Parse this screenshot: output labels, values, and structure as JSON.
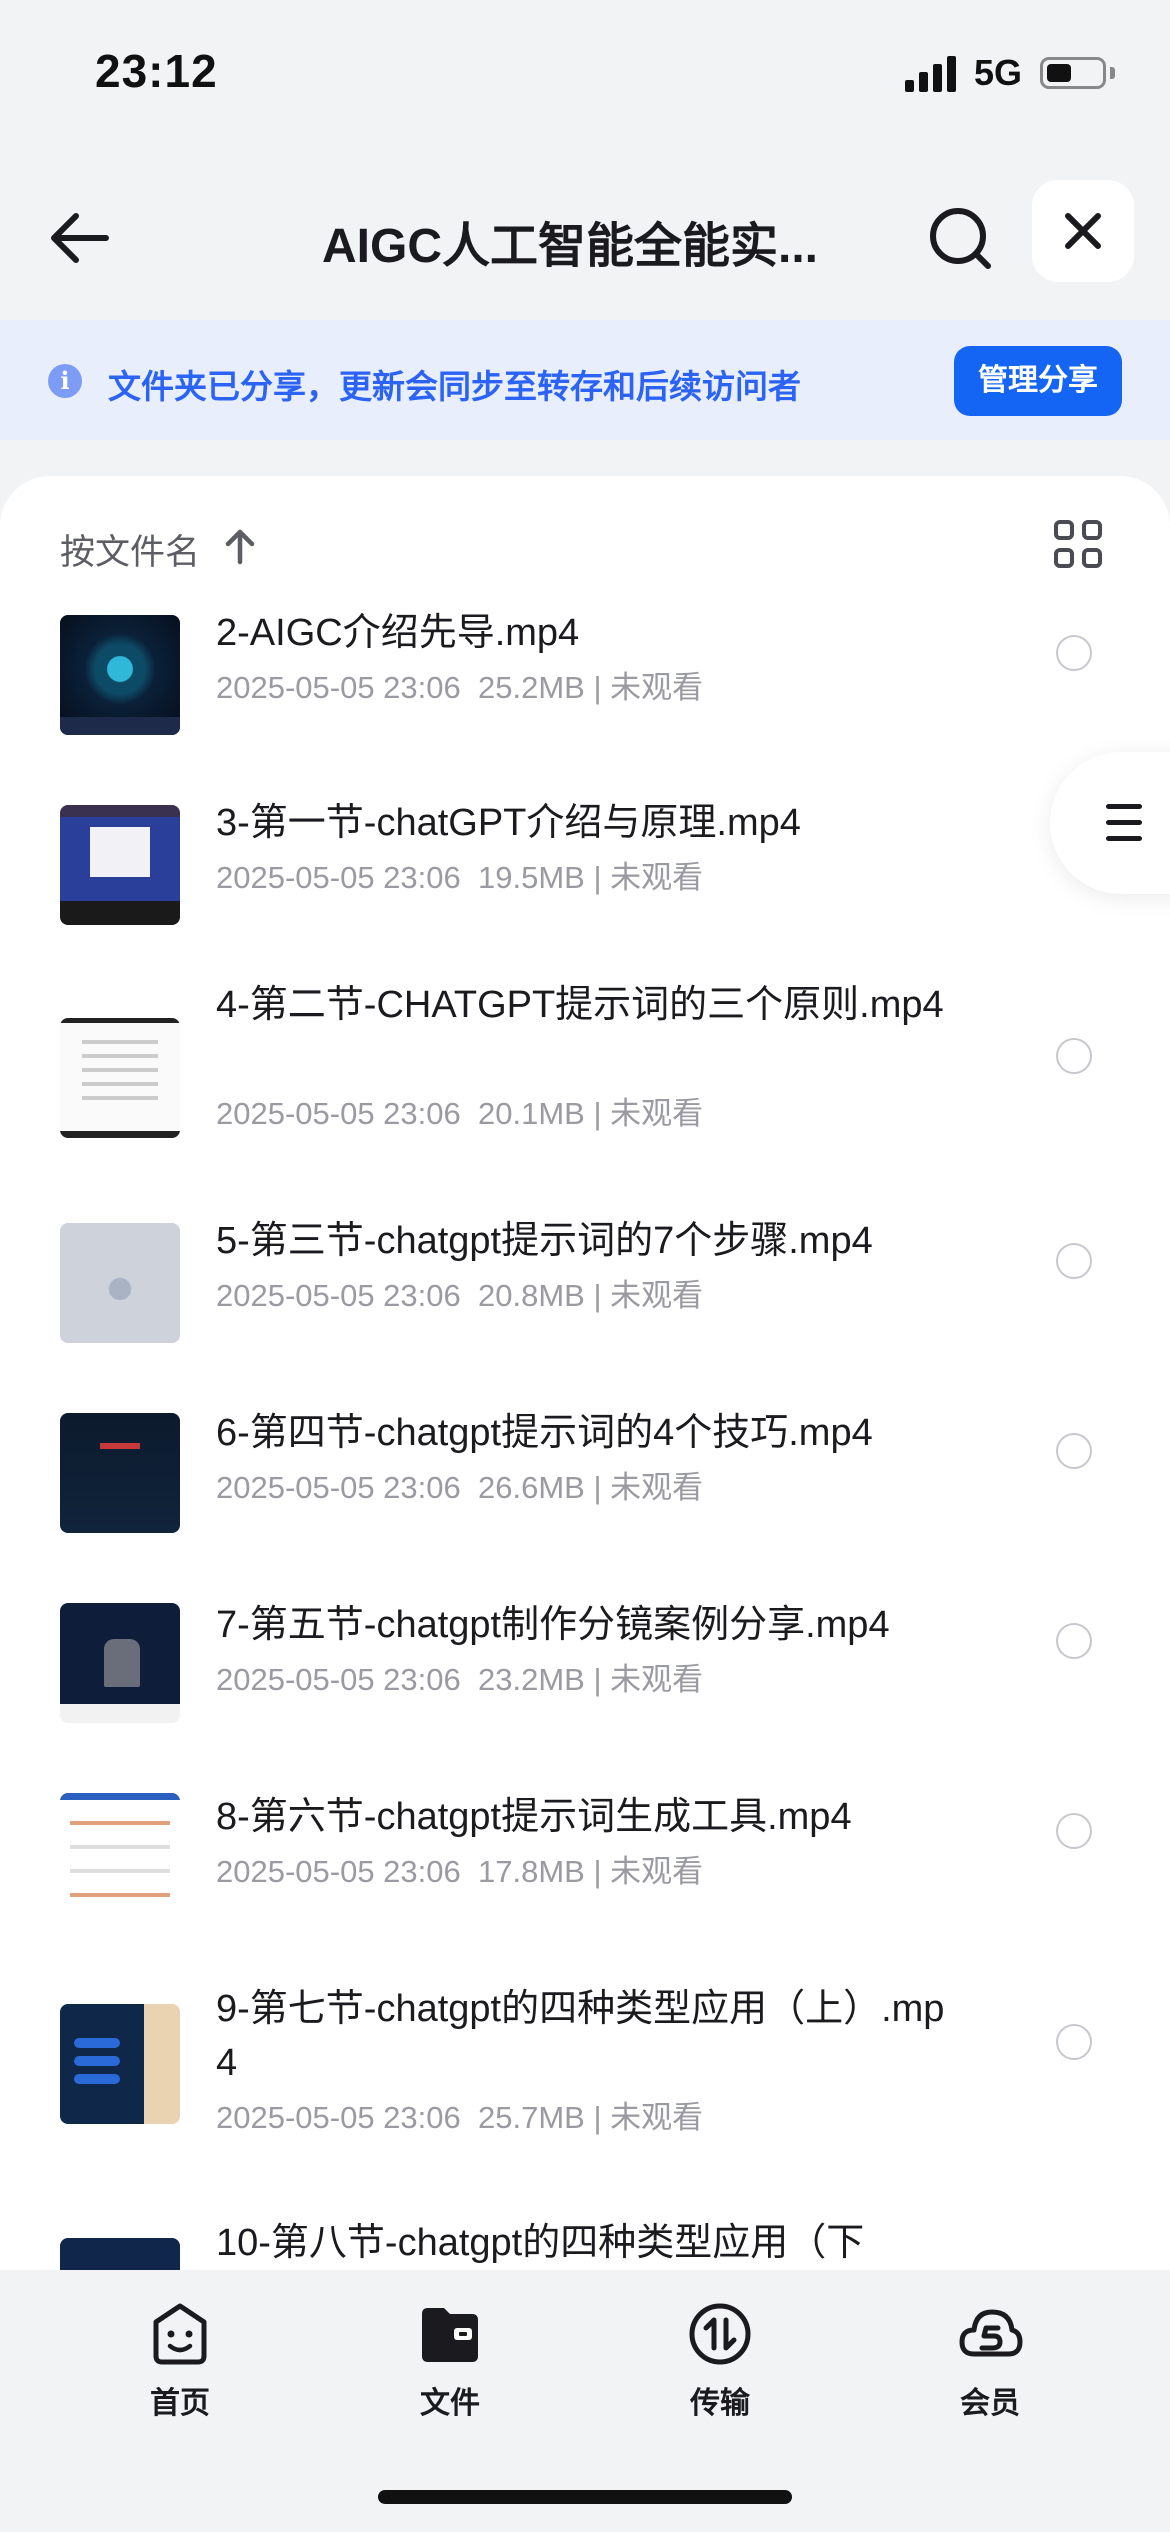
{
  "status_bar": {
    "time": "23:12",
    "network": "5G"
  },
  "nav": {
    "title": "AIGC人工智能全能实..."
  },
  "share_banner": {
    "info_glyph": "i",
    "message": "文件夹已分享，更新会同步至转存和后续访问者",
    "manage_button": "管理分享"
  },
  "sort": {
    "label": "按文件名"
  },
  "files": [
    {
      "name": "2-AIGC介绍先导.mp4",
      "date": "2025-05-05 23:06",
      "size": "25.2MB",
      "status": "未观看"
    },
    {
      "name": "3-第一节-chatGPT介绍与原理.mp4",
      "date": "2025-05-05 23:06",
      "size": "19.5MB",
      "status": "未观看"
    },
    {
      "name": "4-第二节-CHATGPT提示词的三个原则.mp4",
      "date": "2025-05-05 23:06",
      "size": "20.1MB",
      "status": "未观看"
    },
    {
      "name": "5-第三节-chatgpt提示词的7个步骤.mp4",
      "date": "2025-05-05 23:06",
      "size": "20.8MB",
      "status": "未观看"
    },
    {
      "name": "6-第四节-chatgpt提示词的4个技巧.mp4",
      "date": "2025-05-05 23:06",
      "size": "26.6MB",
      "status": "未观看"
    },
    {
      "name": "7-第五节-chatgpt制作分镜案例分享.mp4",
      "date": "2025-05-05 23:06",
      "size": "23.2MB",
      "status": "未观看"
    },
    {
      "name": "8-第六节-chatgpt提示词生成工具.mp4",
      "date": "2025-05-05 23:06",
      "size": "17.8MB",
      "status": "未观看"
    },
    {
      "name": "9-第七节-chatgpt的四种类型应用（上）.mp4",
      "date": "2025-05-05 23:06",
      "size": "25.7MB",
      "status": "未观看"
    },
    {
      "name": "10-第八节-chatgpt的四种类型应用（下",
      "date": "",
      "size": "",
      "status": ""
    }
  ],
  "tabs": [
    {
      "label": "首页",
      "icon": "smile-face-icon"
    },
    {
      "label": "文件",
      "icon": "folder-icon"
    },
    {
      "label": "传输",
      "icon": "transfer-icon"
    },
    {
      "label": "会员",
      "icon": "cloud-member-icon"
    }
  ],
  "colors": {
    "accent": "#1565f4",
    "banner_bg": "#e9eefc",
    "banner_text": "#2a63f6",
    "meta_text": "#9a9aa3"
  }
}
